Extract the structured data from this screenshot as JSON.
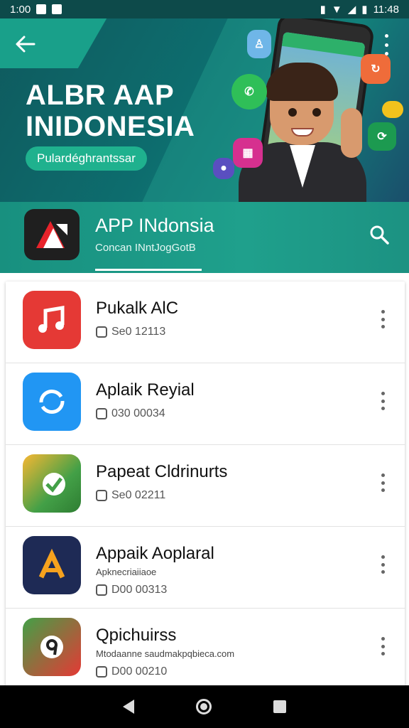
{
  "status_bar": {
    "time_left": "1:00",
    "time_right": "11:48"
  },
  "hero": {
    "title": "ALBR AAP INIDONESIA",
    "pill_label": "Pulardéghrantssar"
  },
  "app_header": {
    "name": "APP INdonsia",
    "subtitle": "Concan INntJogGotB"
  },
  "list": {
    "items": [
      {
        "title": "Pukalk AlC",
        "subtitle": "",
        "meta": "Se0 12113",
        "icon": "music-note-icon",
        "color": "#e53935"
      },
      {
        "title": "Aplaik Reyial",
        "subtitle": "",
        "meta": "030 00034",
        "icon": "sync-arrows-icon",
        "color": "#2196f3"
      },
      {
        "title": "Papeat Cldrinurts",
        "subtitle": "",
        "meta": "Se0 02211",
        "icon": "check-map-icon",
        "color": "#43a047"
      },
      {
        "title": "Appaik Aoplaral",
        "subtitle": "Apknecriaiiaoe",
        "meta": "D00 00313",
        "icon": "letter-a-icon",
        "color": "#1e2a55"
      },
      {
        "title": "Qpichuirss",
        "subtitle": "Mtodaanne saudmakpqbieca.com",
        "meta": "D00 00210",
        "icon": "circle-nine-icon",
        "color": "#43a047"
      }
    ]
  },
  "colors": {
    "hero_bg": "#0d6d6e",
    "header_bg": "#1fa08c",
    "accent": "#1fb18e"
  }
}
